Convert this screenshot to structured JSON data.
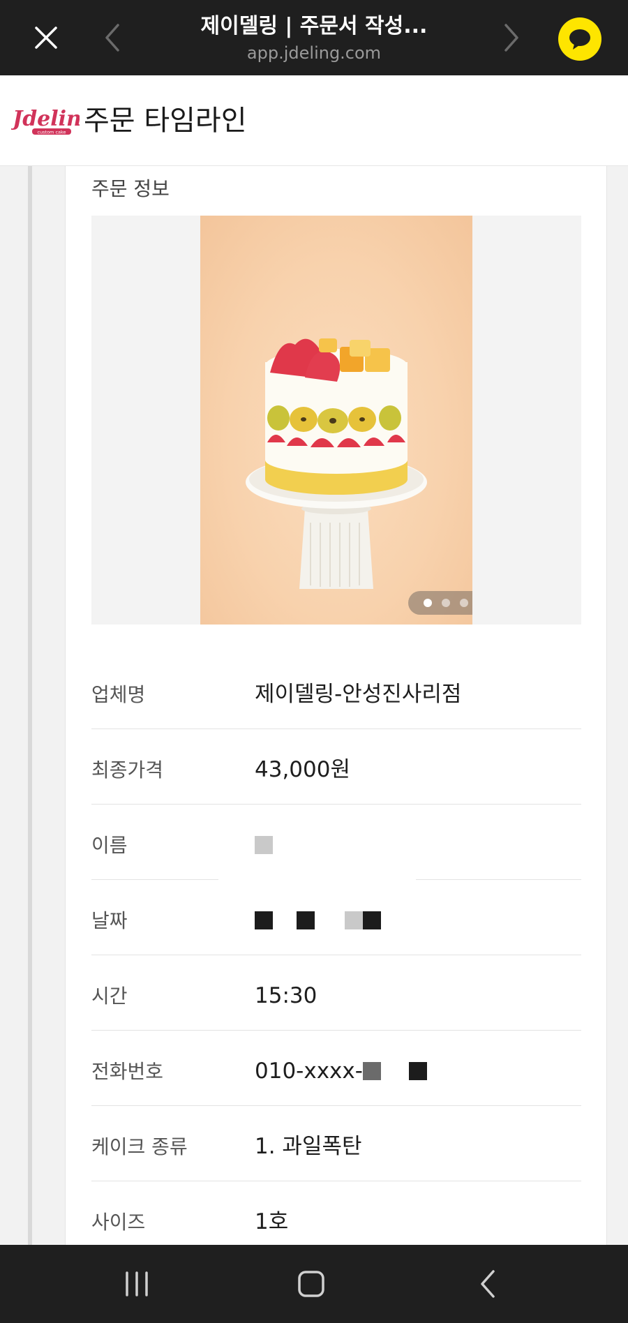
{
  "browser": {
    "title": "제이델링 | 주문서 작성...",
    "url": "app.jdeling.com",
    "icons": {
      "close": "close-icon",
      "back": "chevron-left-icon",
      "forward": "chevron-right-icon",
      "share": "kakaotalk-icon"
    },
    "colors": {
      "bar": "#1f1f1f",
      "kakao": "#fee500"
    }
  },
  "header": {
    "logo_text": "Jdeling",
    "logo_subtext": "custom cake",
    "title": "주문 타임라인",
    "colors": {
      "logo": "#d1335a"
    }
  },
  "order": {
    "section_title": "주문 정보",
    "gallery": {
      "image_count": 3,
      "active_index": 0,
      "image_alt": "과일 케이크"
    },
    "rows": [
      {
        "label": "업체명",
        "value": "제이델링-안성진사리점"
      },
      {
        "label": "최종가격",
        "value": "43,000원"
      },
      {
        "label": "이름",
        "value": ""
      },
      {
        "label": "날짜",
        "value": ""
      },
      {
        "label": "시간",
        "value": "15:30"
      },
      {
        "label": "전화번호",
        "value": "010-xxxx-"
      },
      {
        "label": "케이크 종류",
        "value": "1. 과일폭탄"
      },
      {
        "label": "사이즈",
        "value": "1호"
      }
    ]
  },
  "navbar": {
    "icons": {
      "recent": "recent-apps-icon",
      "home": "home-icon",
      "back": "back-icon"
    }
  }
}
